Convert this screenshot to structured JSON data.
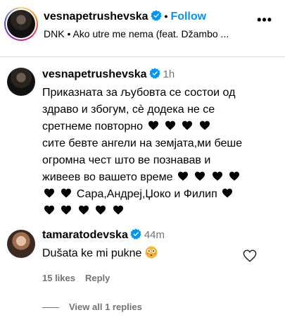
{
  "post": {
    "username": "vesnapetrushevska",
    "separator": "•",
    "follow_label": "Follow",
    "song": "DNK • Ako utre me nema (feat. Džambo ...",
    "more": "•••"
  },
  "comments": [
    {
      "username": "vesnapetrushevska",
      "time": "1h",
      "lines": [
        "Приказната за љубовта се состои од",
        "здраво и збогум, сè додека не се",
        "сретнеме повторно",
        "сите бевте ангели на земјата,ми беше",
        "огромна чест што ве познавав и",
        "живеев во вашето време",
        "",
        "Сара,Андреј,Џоко и Филип"
      ]
    },
    {
      "username": "tamaratodevska",
      "time": "44m",
      "text": "Dušata ke mi pukne",
      "likes": "15 likes",
      "reply_label": "Reply",
      "view_replies": "View all 1 replies"
    }
  ],
  "colors": {
    "follow": "#0095f6",
    "muted": "#737373",
    "verified": "#0095f6"
  }
}
